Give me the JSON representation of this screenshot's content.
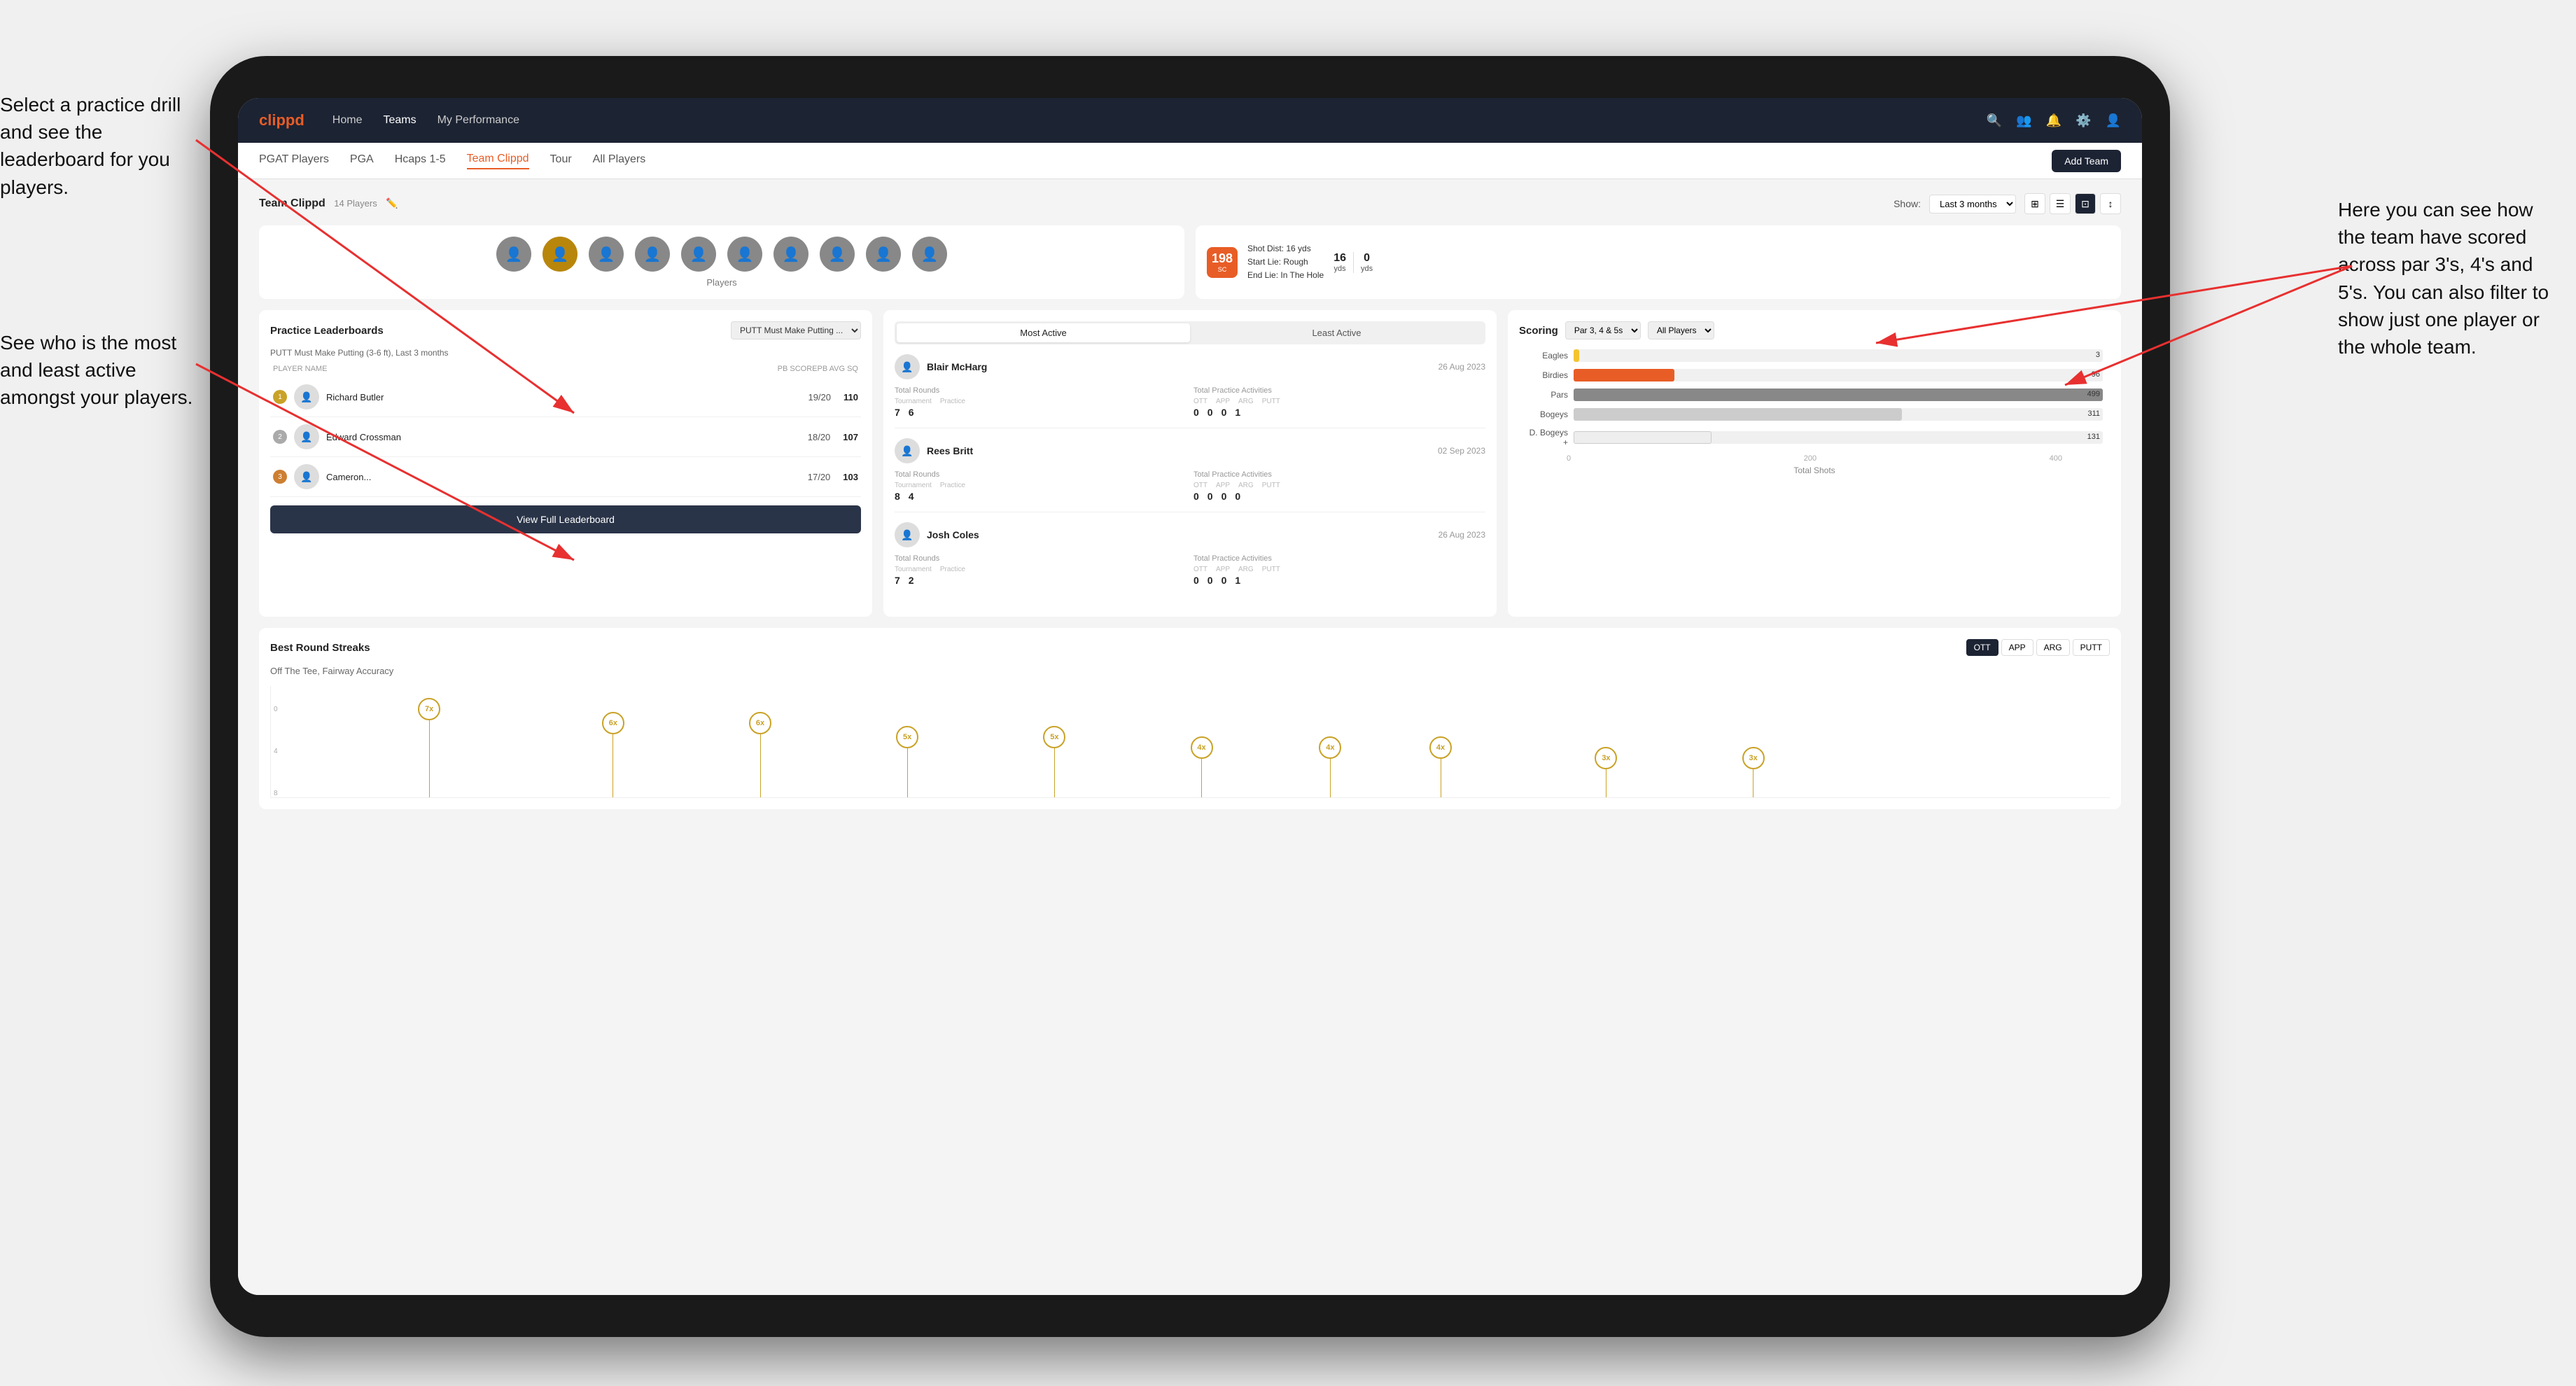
{
  "annotations": {
    "left1": "Select a practice drill and see the leaderboard for you players.",
    "left2": "See who is the most and least active amongst your players.",
    "right1": "Here you can see how the team have scored across par 3's, 4's and 5's.\n\nYou can also filter to show just one player or the whole team."
  },
  "navbar": {
    "brand": "clippd",
    "links": [
      "Home",
      "Teams",
      "My Performance"
    ],
    "active": "Teams"
  },
  "subnav": {
    "tabs": [
      "PGAT Players",
      "PGA",
      "Hcaps 1-5",
      "Team Clippd",
      "Tour",
      "All Players"
    ],
    "active": "Team Clippd",
    "add_team": "Add Team"
  },
  "team_header": {
    "title": "Team Clippd",
    "count": "14 Players",
    "show_label": "Show:",
    "show_value": "Last 3 months",
    "players_label": "Players"
  },
  "shot_card": {
    "badge_num": "198",
    "badge_sub": "SC",
    "shot_dist": "Shot Dist: 16 yds",
    "start_lie": "Start Lie: Rough",
    "end_lie": "End Lie: In The Hole",
    "dist1_label": "yds",
    "dist1_val": "16",
    "dist2_label": "yds",
    "dist2_val": "0"
  },
  "leaderboard": {
    "section_title": "Practice Leaderboards",
    "drill_select": "PUTT Must Make Putting ...",
    "drill_name": "PUTT Must Make Putting (3-6 ft),",
    "drill_period": "Last 3 months",
    "cols": [
      "PLAYER NAME",
      "PB SCORE",
      "PB AVG SQ"
    ],
    "players": [
      {
        "rank": 1,
        "rank_class": "gold",
        "name": "Richard Butler",
        "score": "19/20",
        "avg": "110",
        "avatar": "👤"
      },
      {
        "rank": 2,
        "rank_class": "silver",
        "name": "Edward Crossman",
        "score": "18/20",
        "avg": "107",
        "avatar": "👤"
      },
      {
        "rank": 3,
        "rank_class": "bronze",
        "name": "Cameron...",
        "score": "17/20",
        "avg": "103",
        "avatar": "👤"
      }
    ],
    "view_full": "View Full Leaderboard"
  },
  "activity": {
    "tab_active": "Most Active",
    "tab_inactive": "Least Active",
    "players": [
      {
        "name": "Blair McHarg",
        "date": "26 Aug 2023",
        "total_rounds_label": "Total Rounds",
        "total_practice_label": "Total Practice Activities",
        "tournament_label": "Tournament",
        "practice_label": "Practice",
        "tournament_val": "7",
        "practice_val": "6",
        "ott_label": "OTT",
        "app_label": "APP",
        "arg_label": "ARG",
        "putt_label": "PUTT",
        "ott_val": "0",
        "app_val": "0",
        "arg_val": "0",
        "putt_val": "1"
      },
      {
        "name": "Rees Britt",
        "date": "02 Sep 2023",
        "total_rounds_label": "Total Rounds",
        "total_practice_label": "Total Practice Activities",
        "tournament_label": "Tournament",
        "practice_label": "Practice",
        "tournament_val": "8",
        "practice_val": "4",
        "ott_label": "OTT",
        "app_label": "APP",
        "arg_label": "ARG",
        "putt_label": "PUTT",
        "ott_val": "0",
        "app_val": "0",
        "arg_val": "0",
        "putt_val": "0"
      },
      {
        "name": "Josh Coles",
        "date": "26 Aug 2023",
        "total_rounds_label": "Total Rounds",
        "total_practice_label": "Total Practice Activities",
        "tournament_label": "Tournament",
        "practice_label": "Practice",
        "tournament_val": "7",
        "practice_val": "2",
        "ott_label": "OTT",
        "app_label": "APP",
        "arg_label": "ARG",
        "putt_label": "PUTT",
        "ott_val": "0",
        "app_val": "0",
        "arg_val": "0",
        "putt_val": "1"
      }
    ]
  },
  "scoring": {
    "title": "Scoring",
    "filter1": "Par 3, 4 & 5s",
    "filter2": "All Players",
    "bars": [
      {
        "label": "Eagles",
        "value": 3,
        "max": 500,
        "class": "bar-eagles",
        "display": "3"
      },
      {
        "label": "Birdies",
        "value": 96,
        "max": 500,
        "class": "bar-birdies",
        "display": "96"
      },
      {
        "label": "Pars",
        "value": 499,
        "max": 500,
        "class": "bar-pars",
        "display": "499"
      },
      {
        "label": "Bogeys",
        "value": 311,
        "max": 500,
        "class": "bar-bogeys",
        "display": "311"
      },
      {
        "label": "D. Bogeys +",
        "value": 131,
        "max": 500,
        "class": "bar-dbogeys",
        "display": "131"
      }
    ],
    "x_labels": [
      "0",
      "200",
      "400"
    ],
    "x_title": "Total Shots"
  },
  "streaks": {
    "title": "Best Round Streaks",
    "subtitle": "Off The Tee, Fairway Accuracy",
    "filters": [
      "OTT",
      "APP",
      "ARG",
      "PUTT"
    ],
    "active_filter": "OTT",
    "bubbles": [
      {
        "label": "7x",
        "left_pct": 8,
        "height": 110
      },
      {
        "label": "6x",
        "left_pct": 18,
        "height": 90
      },
      {
        "label": "6x",
        "left_pct": 26,
        "height": 90
      },
      {
        "label": "5x",
        "left_pct": 34,
        "height": 70
      },
      {
        "label": "5x",
        "left_pct": 42,
        "height": 70
      },
      {
        "label": "4x",
        "left_pct": 50,
        "height": 55
      },
      {
        "label": "4x",
        "left_pct": 57,
        "height": 55
      },
      {
        "label": "4x",
        "left_pct": 63,
        "height": 55
      },
      {
        "label": "3x",
        "left_pct": 72,
        "height": 40
      },
      {
        "label": "3x",
        "left_pct": 80,
        "height": 40
      }
    ]
  }
}
